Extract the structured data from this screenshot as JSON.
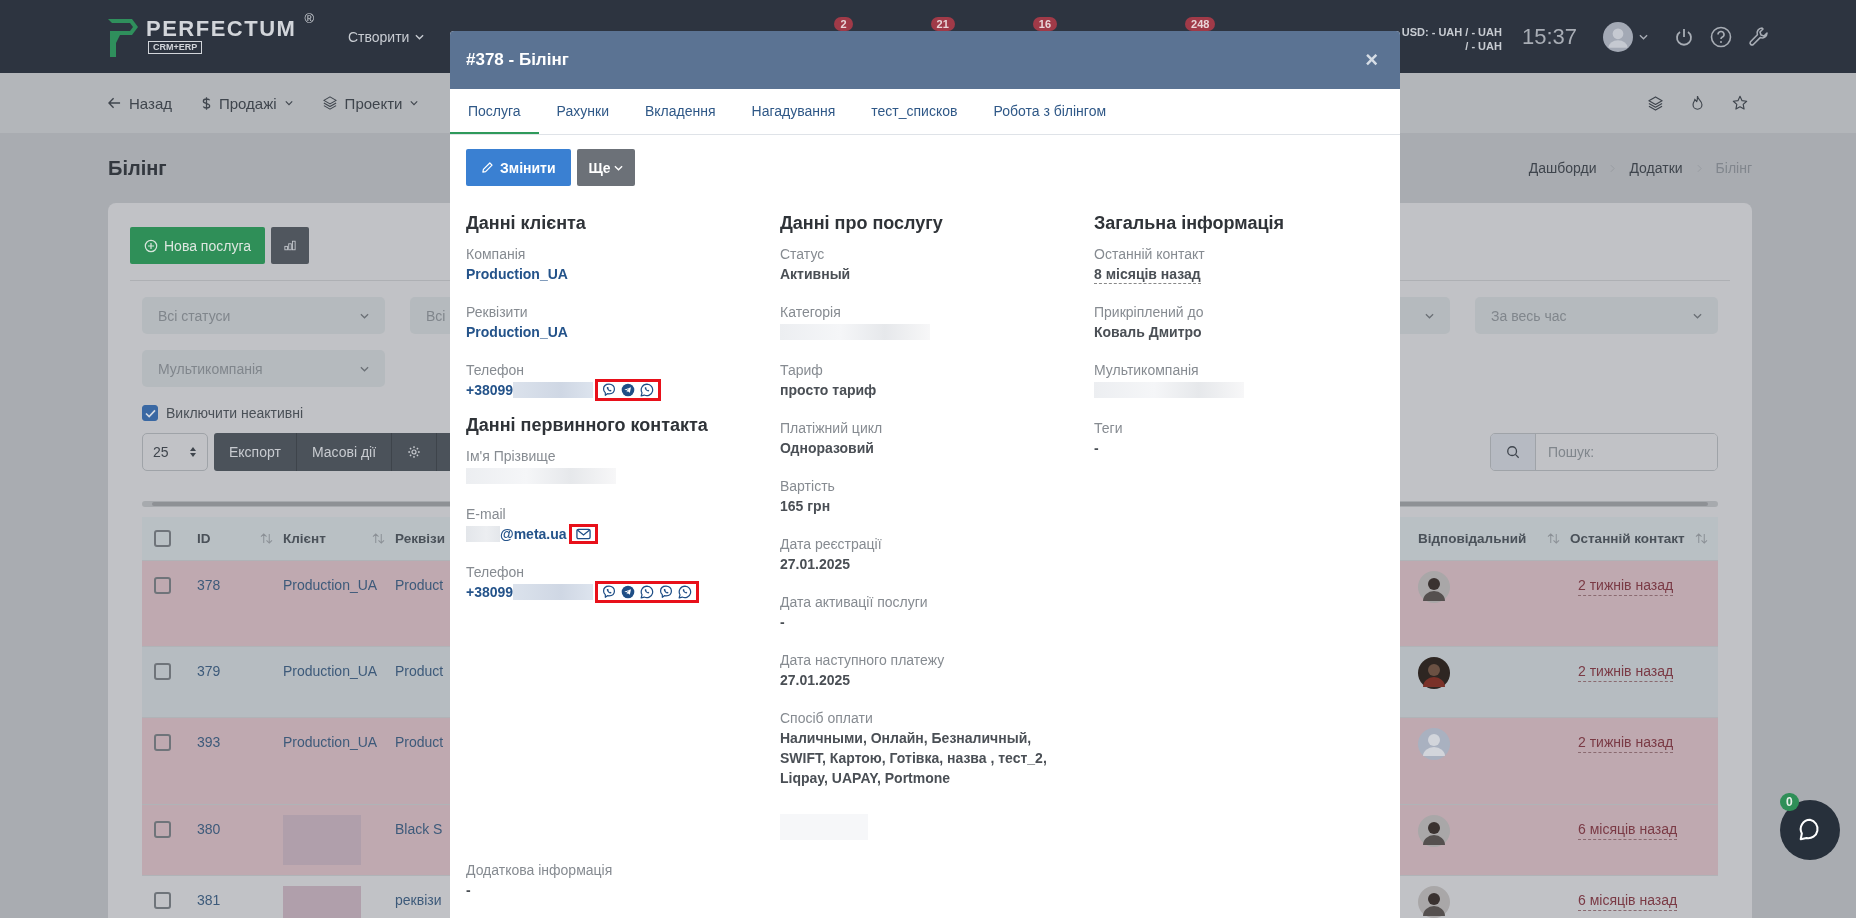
{
  "navbar": {
    "logo": "PERFECTUM",
    "logo_mark": "®",
    "logo_sub": "CRM+ERP",
    "create_menu": "Створити",
    "badges": [
      "2",
      "21",
      "16",
      "248"
    ],
    "currency": [
      "USD: - UAH / - UAH",
      "/ - UAH"
    ],
    "time": "15:37"
  },
  "subnav": {
    "items": [
      {
        "label": "Назад",
        "kind": "back"
      },
      {
        "label": "Продажі",
        "kind": "sales"
      },
      {
        "label": "Проекти",
        "kind": "projects"
      }
    ]
  },
  "page": {
    "title": "Білінг",
    "breadcrumbs": [
      {
        "label": "Дашборди",
        "selected": false
      },
      {
        "label": "Додатки",
        "selected": false
      },
      {
        "label": "Білінг",
        "selected": true
      }
    ]
  },
  "new_button": "Нова послуга",
  "filters": {
    "left": [
      "Всі статуси",
      "Всі"
    ],
    "right": [
      "За весь час"
    ],
    "second_row": [
      "Мультикомпанія"
    ]
  },
  "exclude_inactive": {
    "label": "Виключити неактивні",
    "checked": true
  },
  "page_size": "25",
  "actions": [
    "Експорт",
    "Масові дії"
  ],
  "search": {
    "placeholder": "Пошук:"
  },
  "table": {
    "select_all_checked": false,
    "columns_left": [
      "ID",
      "Клієнт",
      "Реквізи"
    ],
    "columns_right": [
      "Відповідальний",
      "Останній контакт"
    ],
    "rows": [
      {
        "checked": false,
        "id": "378",
        "client": "Production_UA",
        "requisites": "Product",
        "avatar": {
          "kind": "photo"
        },
        "last_contact": "2 тижнів назад",
        "color": "#bfa9b0"
      },
      {
        "checked": false,
        "id": "379",
        "client": "Production_UA",
        "requisites": "Product",
        "avatar": {
          "kind": "dark_photo"
        },
        "last_contact": "2 тижнів назад",
        "color": "#b6bcc1"
      },
      {
        "checked": false,
        "id": "393",
        "client": "Production_UA",
        "requisites": "Product",
        "avatar": {
          "kind": "placeholder"
        },
        "last_contact": "2 тижнів назад",
        "color": "#bfa9b0"
      },
      {
        "checked": false,
        "id": "380",
        "client_redacted": true,
        "requisites": "Black S",
        "avatar": {
          "kind": "photo"
        },
        "last_contact": "6 місяців назад",
        "color": "#bfa9b0"
      },
      {
        "checked": false,
        "id": "381",
        "client_redacted": true,
        "requisites": "реквізи",
        "avatar": {
          "kind": "photo"
        },
        "last_contact": "6 місяців назад",
        "color": "#c1c2c6"
      }
    ]
  },
  "modal": {
    "title": "#378 - Білінг",
    "close": "×",
    "tabs": [
      {
        "label": "Послуга",
        "selected": true
      },
      {
        "label": "Рахунки",
        "selected": false
      },
      {
        "label": "Вкладення",
        "selected": false
      },
      {
        "label": "Нагадування",
        "selected": false
      },
      {
        "label": "тест_списков",
        "selected": false
      },
      {
        "label": "Робота з білінгом",
        "selected": false
      }
    ],
    "edit_button": "Змінити",
    "more_button": "Ще",
    "columns": [
      {
        "sections": [
          {
            "heading": "Данні клієнта",
            "fields": [
              {
                "label": "Компанія",
                "value": "Production_UA",
                "kind": "link"
              },
              {
                "label": "Реквізити",
                "value": "Production_UA",
                "kind": "link"
              },
              {
                "label": "Телефон",
                "value": "+38099",
                "kind": "link",
                "redacted_after": true,
                "icons": [
                  {
                    "kind": "viber"
                  },
                  {
                    "kind": "telegram"
                  },
                  {
                    "kind": "whatsapp"
                  }
                ]
              }
            ]
          },
          {
            "heading": "Данні первинного контакта",
            "fields": [
              {
                "label": "Ім'я Прізвище",
                "kind": "text",
                "redacted_after": true
              },
              {
                "label": "E-mail",
                "value": "@meta.ua",
                "kind": "link",
                "redacted_before": true,
                "icons": [
                  {
                    "kind": "mail"
                  }
                ]
              },
              {
                "label": "Телефон",
                "value": "+38099",
                "kind": "link",
                "redacted_after": true,
                "icons": [
                  {
                    "kind": "viber"
                  },
                  {
                    "kind": "telegram"
                  },
                  {
                    "kind": "whatsapp"
                  },
                  {
                    "kind": "viber"
                  },
                  {
                    "kind": "whatsapp"
                  }
                ]
              }
            ]
          }
        ]
      },
      {
        "sections": [
          {
            "heading": "Данні про послугу",
            "trailing_redacted": true,
            "fields": [
              {
                "label": "Статус",
                "value": "Активный",
                "kind": "text"
              },
              {
                "label": "Категорія",
                "kind": "text",
                "redacted_after": true
              },
              {
                "label": "Тариф",
                "value": "просто тариф",
                "kind": "text"
              },
              {
                "label": "Платіжний цикл",
                "value": "Одноразовий",
                "kind": "text"
              },
              {
                "label": "Вартість",
                "value": "165 грн",
                "kind": "text"
              },
              {
                "label": "Дата реєстрації",
                "value": "27.01.2025",
                "kind": "text"
              },
              {
                "label": "Дата активації послуги",
                "value": "-",
                "kind": "text"
              },
              {
                "label": "Дата наступного платежу",
                "value": "27.01.2025",
                "kind": "text"
              },
              {
                "label": "Спосіб оплати",
                "value": "Наличными, Онлайн, Безналичный, SWIFT, Картою, Готівка, назва , тест_2, Liqpay, UAPAY, Portmone",
                "kind": "text"
              }
            ]
          }
        ]
      },
      {
        "sections": [
          {
            "heading": "Загальна інформація",
            "fields": [
              {
                "label": "Останній контакт",
                "value": "8 місяців назад",
                "kind": "time"
              },
              {
                "label": "Прикріплений до",
                "value": "Коваль Дмитро",
                "kind": "text"
              },
              {
                "label": "Мультикомпанія",
                "kind": "text",
                "redacted_after": true
              },
              {
                "label": "Теги",
                "value": "-",
                "kind": "text"
              }
            ]
          }
        ]
      }
    ],
    "additional": {
      "label": "Додаткова інформація",
      "value": "-"
    }
  },
  "chat": {
    "badge": "0"
  }
}
